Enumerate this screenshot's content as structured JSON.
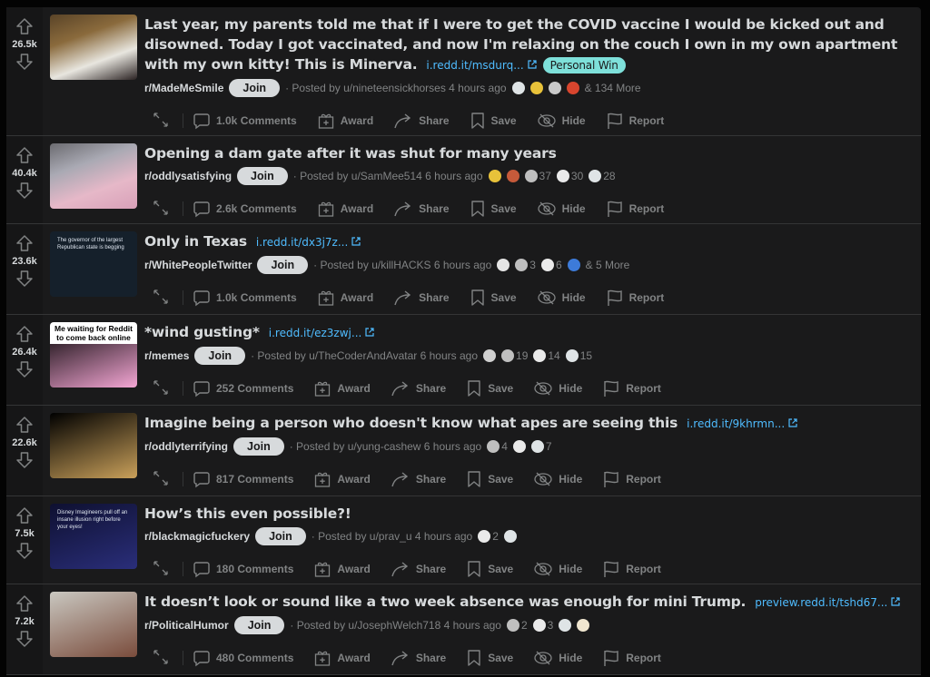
{
  "actions": {
    "award": "Award",
    "share": "Share",
    "save": "Save",
    "hide": "Hide",
    "report": "Report",
    "join": "Join"
  },
  "posts": [
    {
      "score": "26.5k",
      "title": "Last year, my parents told me that if I were to get the COVID vaccine I would be kicked out and disowned. Today I got vaccinated, and now I'm relaxing on the couch I own in my own apartment with my own kitty! This is Minerva.",
      "link": "i.redd.it/msdurq...",
      "flair": "Personal Win",
      "subreddit": "r/MadeMeSmile",
      "posted_by": "· Posted by u/nineteensickhorses 4 hours ago",
      "awards": [
        {
          "name": "wholesome-award",
          "count": ""
        },
        {
          "name": "gold-award",
          "count": ""
        },
        {
          "name": "rocket-award",
          "count": ""
        },
        {
          "name": "gift-award",
          "count": ""
        }
      ],
      "more": "& 134 More",
      "comments": "1.0k Comments"
    },
    {
      "score": "40.4k",
      "title": "Opening a dam gate after it was shut for many years",
      "link": "",
      "flair": "",
      "subreddit": "r/oddlysatisfying",
      "posted_by": "· Posted by u/SamMee514 6 hours ago",
      "awards": [
        {
          "name": "gold-award",
          "count": ""
        },
        {
          "name": "chef-award",
          "count": ""
        },
        {
          "name": "silver-award",
          "count": "37"
        },
        {
          "name": "helpful-award",
          "count": "30"
        },
        {
          "name": "wholesome-award",
          "count": "28"
        }
      ],
      "more": "",
      "comments": "2.6k Comments"
    },
    {
      "score": "23.6k",
      "title": "Only in Texas",
      "link": "i.redd.it/dx3j7z...",
      "flair": "",
      "subreddit": "r/WhitePeopleTwitter",
      "posted_by": "· Posted by u/killHACKS 6 hours ago",
      "awards": [
        {
          "name": "bravo-award",
          "count": ""
        },
        {
          "name": "silver-award",
          "count": "3"
        },
        {
          "name": "helpful-award",
          "count": "6"
        },
        {
          "name": "eagle-award",
          "count": ""
        }
      ],
      "more": "& 5 More",
      "comments": "1.0k Comments"
    },
    {
      "score": "26.4k",
      "title": "*wind gusting*",
      "link": "i.redd.it/ez3zwj...",
      "flair": "",
      "subreddit": "r/memes",
      "posted_by": "· Posted by u/TheCoderAndAvatar 6 hours ago",
      "awards": [
        {
          "name": "genie-award",
          "count": ""
        },
        {
          "name": "silver-award",
          "count": "19"
        },
        {
          "name": "helpful-award",
          "count": "14"
        },
        {
          "name": "wholesome-award",
          "count": "15"
        }
      ],
      "more": "",
      "comments": "252 Comments"
    },
    {
      "score": "22.6k",
      "title": "Imagine being a person who doesn't know what apes are seeing this",
      "link": "i.redd.it/9khrmn...",
      "flair": "",
      "subreddit": "r/oddlyterrifying",
      "posted_by": "· Posted by u/yung-cashew 6 hours ago",
      "awards": [
        {
          "name": "silver-award",
          "count": "4"
        },
        {
          "name": "helpful-award",
          "count": ""
        },
        {
          "name": "wholesome-award",
          "count": "7"
        }
      ],
      "more": "",
      "comments": "817 Comments"
    },
    {
      "score": "7.5k",
      "title": "How’s this even possible?!",
      "link": "",
      "flair": "",
      "subreddit": "r/blackmagicfuckery",
      "posted_by": "· Posted by u/prav_u 4 hours ago",
      "awards": [
        {
          "name": "helpful-award",
          "count": "2"
        },
        {
          "name": "wholesome-award",
          "count": ""
        }
      ],
      "more": "",
      "comments": "180 Comments"
    },
    {
      "score": "7.2k",
      "title": "It doesn’t look or sound like a two week absence was enough for mini Trump.",
      "link": "preview.redd.it/tshd67...",
      "flair": "",
      "subreddit": "r/PoliticalHumor",
      "posted_by": "· Posted by u/JosephWelch718 4 hours ago",
      "awards": [
        {
          "name": "silver-award",
          "count": "2"
        },
        {
          "name": "helpful-award",
          "count": "3"
        },
        {
          "name": "wholesome-award",
          "count": ""
        },
        {
          "name": "snoo-award",
          "count": ""
        }
      ],
      "more": "",
      "comments": "480 Comments"
    }
  ],
  "thumbnails": [
    {
      "desc": "cat-on-sock",
      "colors": [
        "#5a4428",
        "#8a6a3c",
        "#e8e6df",
        "#2a2222"
      ]
    },
    {
      "desc": "dam-gate",
      "colors": [
        "#6b6b70",
        "#a9a9b3",
        "#e6b8c8",
        "#d8a0b8"
      ]
    },
    {
      "desc": "tweet-screenshot",
      "colors": [
        "#15202b",
        "#15202b"
      ],
      "text": "The governor of the largest Republican state is begging"
    },
    {
      "desc": "meme-wind",
      "colors": [
        "#000000",
        "#f4a6d4"
      ],
      "text": "Me waiting for Reddit to come back online"
    },
    {
      "desc": "skeleton",
      "colors": [
        "#000000",
        "#c9a05a"
      ]
    },
    {
      "desc": "disney-illusion",
      "colors": [
        "#0e1030",
        "#2a2e7a"
      ],
      "text": "Disney Imagineers pull off an insane illusion right before your eyes!"
    },
    {
      "desc": "political-photo",
      "colors": [
        "#c9c7c0",
        "#7a4c3c"
      ]
    }
  ]
}
